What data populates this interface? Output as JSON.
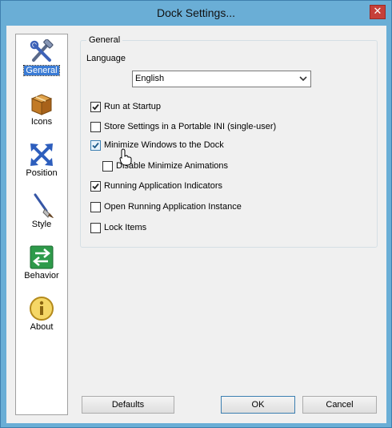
{
  "window": {
    "title": "Dock Settings...",
    "close_glyph": "✕"
  },
  "sidebar": {
    "items": [
      {
        "label": "General",
        "icon": "tools-icon",
        "selected": true
      },
      {
        "label": "Icons",
        "icon": "box-icon",
        "selected": false
      },
      {
        "label": "Position",
        "icon": "move-arrows-icon",
        "selected": false
      },
      {
        "label": "Style",
        "icon": "brush-icon",
        "selected": false
      },
      {
        "label": "Behavior",
        "icon": "swap-arrows-icon",
        "selected": false
      },
      {
        "label": "About",
        "icon": "info-icon",
        "selected": false
      }
    ]
  },
  "general": {
    "group_title": "General",
    "language_label": "Language",
    "language_value": "English",
    "options": {
      "run_at_startup": {
        "label": "Run at Startup",
        "checked": true
      },
      "portable_ini": {
        "label": "Store Settings in a Portable INI (single-user)",
        "checked": false
      },
      "minimize_to_dock": {
        "label": "Minimize Windows to the Dock",
        "checked": true
      },
      "disable_min_anim": {
        "label": "Disable Minimize Animations",
        "checked": false
      },
      "running_indicators": {
        "label": "Running Application Indicators",
        "checked": true
      },
      "open_running_instance": {
        "label": "Open Running Application Instance",
        "checked": false
      },
      "lock_items": {
        "label": "Lock Items",
        "checked": false
      }
    }
  },
  "buttons": {
    "defaults": "Defaults",
    "ok": "OK",
    "cancel": "Cancel"
  },
  "colors": {
    "titlebar": "#6aaed6",
    "close": "#c6403a",
    "selection": "#3a7bd5"
  }
}
